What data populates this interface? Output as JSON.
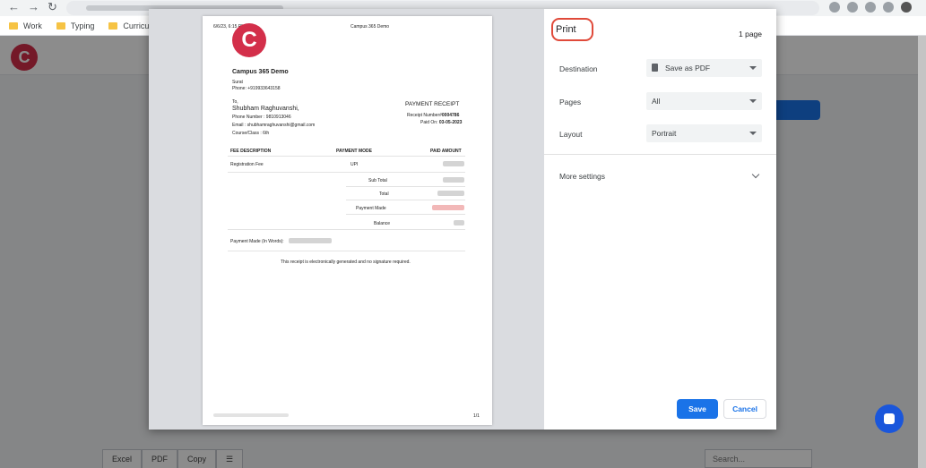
{
  "bookmarks": [
    "Work",
    "Typing",
    "Curriculum"
  ],
  "app": {
    "logo_letter": "C",
    "buttons": [
      "Excel",
      "PDF",
      "Copy"
    ],
    "search_placeholder": "Search..."
  },
  "print_dialog": {
    "title": "Print",
    "page_count": "1 page",
    "destination_label": "Destination",
    "destination_value": "Save as PDF",
    "pages_label": "Pages",
    "pages_value": "All",
    "layout_label": "Layout",
    "layout_value": "Portrait",
    "more_settings": "More settings",
    "save_label": "Save",
    "cancel_label": "Cancel"
  },
  "receipt": {
    "header_time": "6/6/23, 6:15 PM",
    "header_title": "Campus 365 Demo",
    "logo_letter": "C",
    "school_name": "Campus 365 Demo",
    "city": "Surat",
    "phone": "Phone: +919933643158",
    "to_label": "To,",
    "student_name": "Shubham Raghuvanshi,",
    "student_phone": "Phone Number : 9810913046",
    "student_email": "Email : shubhamraghuvanshi@gmail.com",
    "course": "Course/Class : 6th",
    "receipt_title": "PAYMENT RECEIPT",
    "receipt_number_label": "Receipt Number#",
    "receipt_number": "0004786",
    "paid_on_label": "Paid On:",
    "paid_on": "03-05-2023",
    "col_fee": "FEE DESCRIPTION",
    "col_mode": "PAYMENT MODE",
    "col_amount": "PAID AMOUNT",
    "fee_item": "Registration Fee",
    "fee_mode": "UPI",
    "sub_total": "Sub Total",
    "total": "Total",
    "payment_made": "Payment Made",
    "balance": "Balance",
    "payment_words": "Payment Made (In Words):",
    "footer_note": "This receipt is electronically generated and no signature required.",
    "page_footer_right": "1/1"
  },
  "colors": {
    "brand": "#d32f4a",
    "accent": "#1a73e8",
    "highlight": "#e04a3a"
  }
}
